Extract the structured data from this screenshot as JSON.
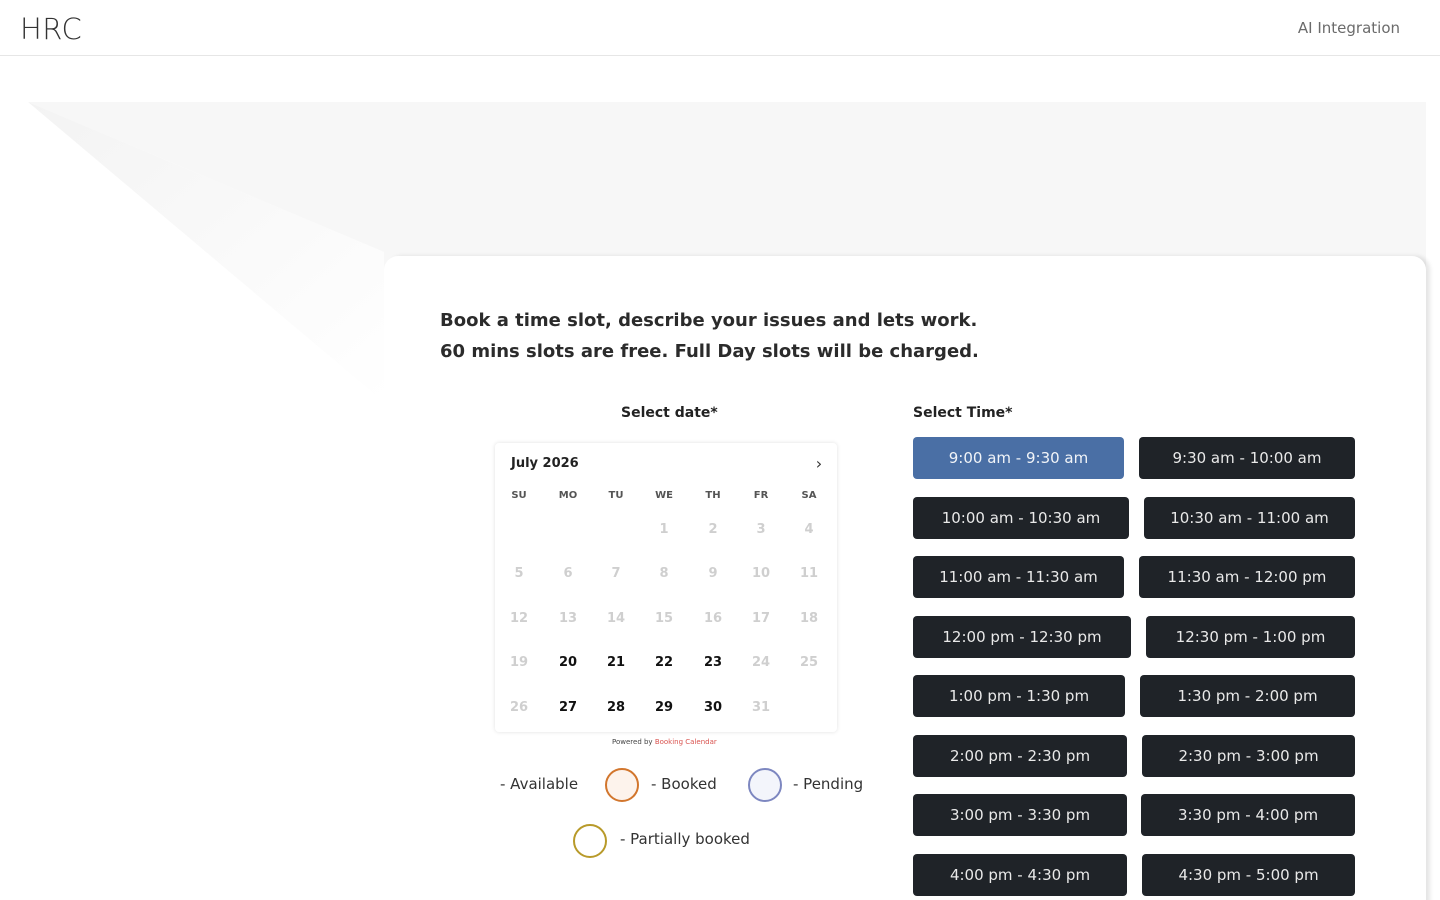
{
  "header": {
    "logo": "HRC",
    "nav_link": "AI Integration"
  },
  "intro": {
    "line1": "Book a time slot, describe your issues and lets work.",
    "line2": "60 mins slots are free. Full Day slots will be charged."
  },
  "labels": {
    "select_date": "Select date*",
    "select_time": "Select Time*"
  },
  "calendar": {
    "month": "July 2026",
    "next_icon": "chevron-right-icon",
    "days_of_week": [
      "SU",
      "MO",
      "TU",
      "WE",
      "TH",
      "FR",
      "SA"
    ],
    "weeks": [
      [
        {
          "d": ""
        },
        {
          "d": ""
        },
        {
          "d": ""
        },
        {
          "d": "1"
        },
        {
          "d": "2"
        },
        {
          "d": "3"
        },
        {
          "d": "4"
        }
      ],
      [
        {
          "d": "5"
        },
        {
          "d": "6"
        },
        {
          "d": "7"
        },
        {
          "d": "8"
        },
        {
          "d": "9"
        },
        {
          "d": "10"
        },
        {
          "d": "11"
        }
      ],
      [
        {
          "d": "12"
        },
        {
          "d": "13"
        },
        {
          "d": "14"
        },
        {
          "d": "15"
        },
        {
          "d": "16"
        },
        {
          "d": "17"
        },
        {
          "d": "18"
        }
      ],
      [
        {
          "d": "19"
        },
        {
          "d": "20",
          "available": true
        },
        {
          "d": "21",
          "available": true
        },
        {
          "d": "22",
          "available": true
        },
        {
          "d": "23",
          "available": true
        },
        {
          "d": "24"
        },
        {
          "d": "25"
        }
      ],
      [
        {
          "d": "26"
        },
        {
          "d": "27",
          "available": true
        },
        {
          "d": "28",
          "available": true
        },
        {
          "d": "29",
          "available": true
        },
        {
          "d": "30",
          "available": true
        },
        {
          "d": "31"
        },
        {
          "d": ""
        }
      ]
    ]
  },
  "powered": {
    "prefix": "Powered by",
    "link": "Booking Calendar"
  },
  "legend": {
    "available": "- Available",
    "booked": "- Booked",
    "pending": "- Pending",
    "partially_booked": "- Partially booked",
    "colors": {
      "booked": "#d2762d",
      "pending": "#7d87c0",
      "partial": "#b89a2a"
    }
  },
  "time_slots": [
    [
      "9:00 am - 9:30 am",
      "9:30 am - 10:00 am"
    ],
    [
      "10:00 am - 10:30 am",
      "10:30 am - 11:00 am"
    ],
    [
      "11:00 am - 11:30 am",
      "11:30 am - 12:00 pm"
    ],
    [
      "12:00 pm - 12:30 pm",
      "12:30 pm - 1:00 pm"
    ],
    [
      "1:00 pm - 1:30 pm",
      "1:30 pm - 2:00 pm"
    ],
    [
      "2:00 pm - 2:30 pm",
      "2:30 pm - 3:00 pm"
    ],
    [
      "3:00 pm - 3:30 pm",
      "3:30 pm - 4:00 pm"
    ],
    [
      "4:00 pm - 4:30 pm",
      "4:30 pm - 5:00 pm"
    ]
  ],
  "selected_slot": "9:00 am - 9:30 am",
  "colors": {
    "slot_bg": "#1f2328",
    "slot_selected_bg": "#4a6fa5"
  }
}
